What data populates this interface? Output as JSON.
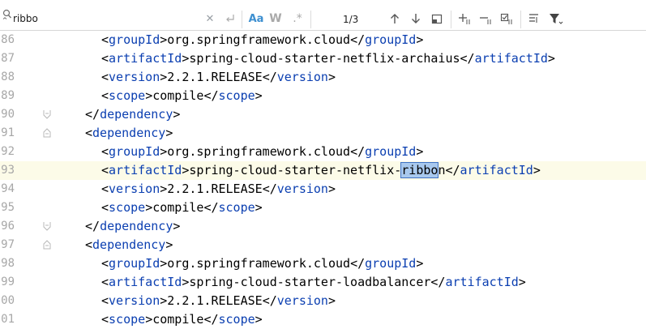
{
  "find": {
    "query": "ribbo",
    "match_case_label": "Aa",
    "words_label": "W",
    "regex_label": ".*",
    "count": "1/3"
  },
  "editor": {
    "lines": [
      {
        "num": "86",
        "indent": 2,
        "tag": "groupId",
        "value": "org.springframework.cloud"
      },
      {
        "num": "87",
        "indent": 2,
        "tag": "artifactId",
        "value": "spring-cloud-starter-netflix-archaius"
      },
      {
        "num": "88",
        "indent": 2,
        "tag": "version",
        "value": "2.2.1.RELEASE"
      },
      {
        "num": "89",
        "indent": 2,
        "tag": "scope",
        "value": "compile"
      },
      {
        "num": "90",
        "indent": 1,
        "close": "dependency"
      },
      {
        "num": "91",
        "indent": 1,
        "open": "dependency"
      },
      {
        "num": "92",
        "indent": 2,
        "tag": "groupId",
        "value": "org.springframework.cloud"
      },
      {
        "num": "93",
        "indent": 2,
        "tag": "artifactId",
        "value_pre": "spring-cloud-starter-netflix-",
        "match": "ribbo",
        "value_post": "n",
        "current": true
      },
      {
        "num": "94",
        "indent": 2,
        "tag": "version",
        "value": "2.2.1.RELEASE"
      },
      {
        "num": "95",
        "indent": 2,
        "tag": "scope",
        "value": "compile"
      },
      {
        "num": "96",
        "indent": 1,
        "close": "dependency"
      },
      {
        "num": "97",
        "indent": 1,
        "open": "dependency"
      },
      {
        "num": "98",
        "indent": 2,
        "tag": "groupId",
        "value": "org.springframework.cloud"
      },
      {
        "num": "99",
        "indent": 2,
        "tag": "artifactId",
        "value": "spring-cloud-starter-loadbalancer"
      },
      {
        "num": "00",
        "indent": 2,
        "tag": "version",
        "value": "2.2.1.RELEASE"
      },
      {
        "num": "01",
        "indent": 2,
        "tag": "scope",
        "value": "compile"
      }
    ]
  }
}
